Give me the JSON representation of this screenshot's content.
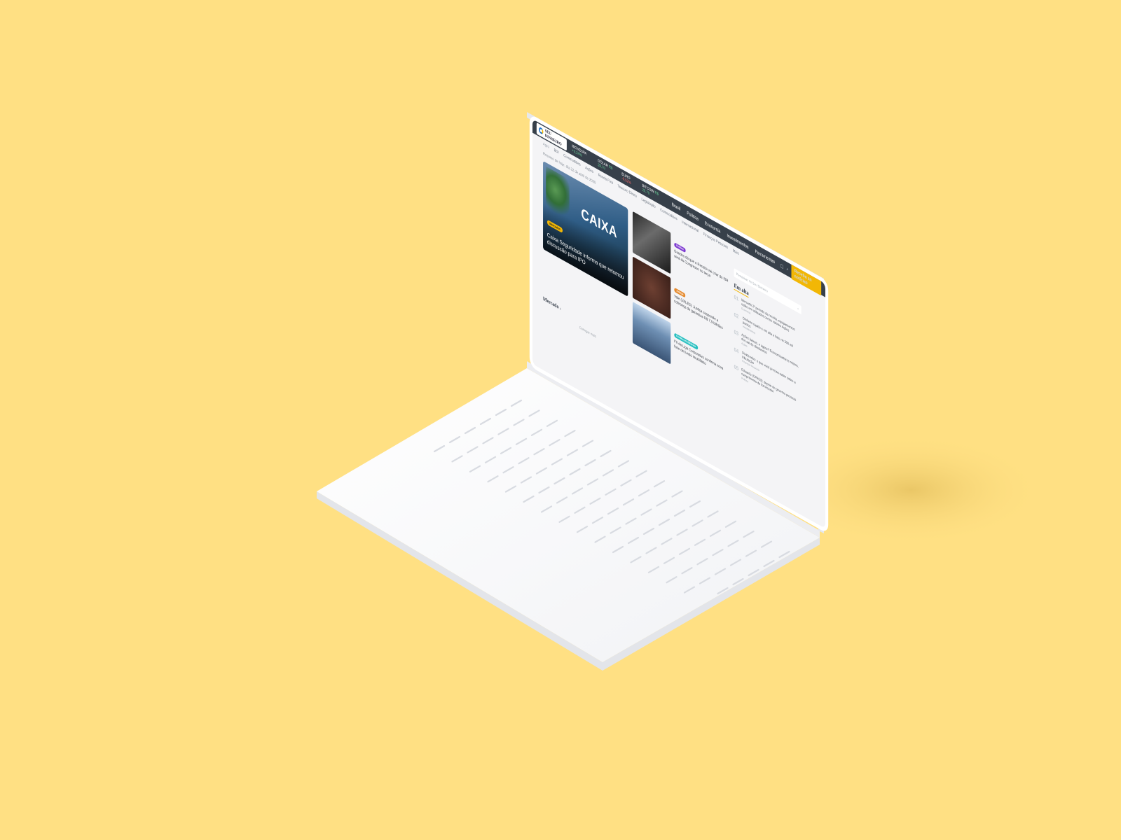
{
  "header": {
    "logo_text": "SEU DINHEIRO",
    "ticker": [
      {
        "label": "IBOVESPA",
        "value": "+2,24%",
        "dir": "up"
      },
      {
        "label": "DÓLAR",
        "value": "R$ 20,70",
        "dir": "up"
      },
      {
        "label": "EURO",
        "value": "-0,52%",
        "dir": "down"
      },
      {
        "label": "BITCOIN",
        "value": "R$ 20,70",
        "dir": "up"
      }
    ],
    "nav": [
      "Brasil",
      "Política",
      "Economia",
      "Investimentos",
      "Ferramentas"
    ],
    "cta_label": "Receba as notícias"
  },
  "subnav": [
    "Agro",
    "BDI",
    "Commodities",
    "Ações",
    "Renda Fixa",
    "Tesouro Direto",
    "Legislação",
    "Commodities",
    "Internacional",
    "Finanças Pessoais",
    "Mais"
  ],
  "date_text": "Resumo de hoje, dia 22 de abril de 2020",
  "hero": {
    "sign": "CAIXA",
    "tag": "Mercados",
    "title": "Caixa Seguridade informa que retomou discussão para IPO"
  },
  "stories": [
    {
      "tag": "Política",
      "color": "purple",
      "title": "Guedes dá que a Receita vai criar do ISR será do Congresso no terça"
    },
    {
      "tag": "Justiça",
      "color": "orange",
      "title": "Vale (VALE3): Justiça suspende a cobrança de garantias R$ 7,9 bilhões"
    },
    {
      "tag": "Fundos imobiliários",
      "color": "teal",
      "title": "FII da Liga Corporativo confirma nova fase de fundo imobiliário"
    }
  ],
  "right": {
    "search_placeholder": "Pesquisar no Seu Dinheiro",
    "search_icon": "search-icon",
    "title": "Em alta",
    "items": [
      {
        "num": "01",
        "text": "Mercado 2º período da receita, equipamentos estão em utilizados certos valores Ações",
        "meta": "Economia"
      },
      {
        "num": "02",
        "text": "Dinheiro rapido e em alta e feito no 300 mil pontos",
        "meta": "Investimentos"
      },
      {
        "num": "03",
        "text": "Ações baixas, e agora? Economizadores mistos, dos sal de dividendos",
        "meta": "Ações"
      },
      {
        "num": "04",
        "text": "Dividendos: o que você precisa saber sobre a tributação",
        "meta": "Finanças Pessoais"
      },
      {
        "num": "05",
        "text": "Eduardo (CPAS3): depois do governo pessoas cumprimento do fornecedor",
        "meta": "Política"
      }
    ]
  },
  "loading_text": "Carregar mais",
  "section_label": "Mercado",
  "colors": {
    "background": "#FFE083",
    "accent": "#F2B705",
    "topbar": "#37404A"
  }
}
